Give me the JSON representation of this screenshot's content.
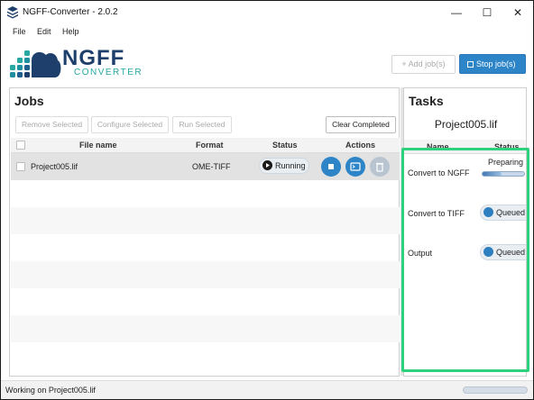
{
  "window": {
    "title": "NGFF-Converter - 2.0.2",
    "minimize": "—",
    "maximize": "☐",
    "close": "✕"
  },
  "menu": [
    "File",
    "Edit",
    "Help"
  ],
  "logo": {
    "line1": "NGFF",
    "line2": "CONVERTER"
  },
  "toolbar": {
    "add_label": "+ Add job(s)",
    "stop_label": "Stop job(s)"
  },
  "jobs": {
    "title": "Jobs",
    "buttons": {
      "remove": "Remove Selected",
      "configure": "Configure Selected",
      "run": "Run Selected",
      "clear": "Clear Completed"
    },
    "columns": {
      "file": "File name",
      "format": "Format",
      "status": "Status",
      "actions": "Actions"
    },
    "rows": [
      {
        "file": "Project005.lif",
        "format": "OME-TIFF",
        "status": "Running"
      }
    ]
  },
  "tasks": {
    "title": "Tasks",
    "file": "Project005.lif",
    "columns": {
      "name": "Name",
      "status": "Status"
    },
    "items": [
      {
        "name": "Convert to NGFF",
        "status": "Preparing"
      },
      {
        "name": "Convert to TIFF",
        "status": "Queued"
      },
      {
        "name": "Output",
        "status": "Queued"
      }
    ]
  },
  "statusbar": {
    "text": "Working on Project005.lif"
  },
  "colors": {
    "accent": "#2d85c8",
    "highlight": "#2fd17c",
    "logo_dark": "#1e3f6b",
    "logo_teal": "#27a8a3"
  }
}
